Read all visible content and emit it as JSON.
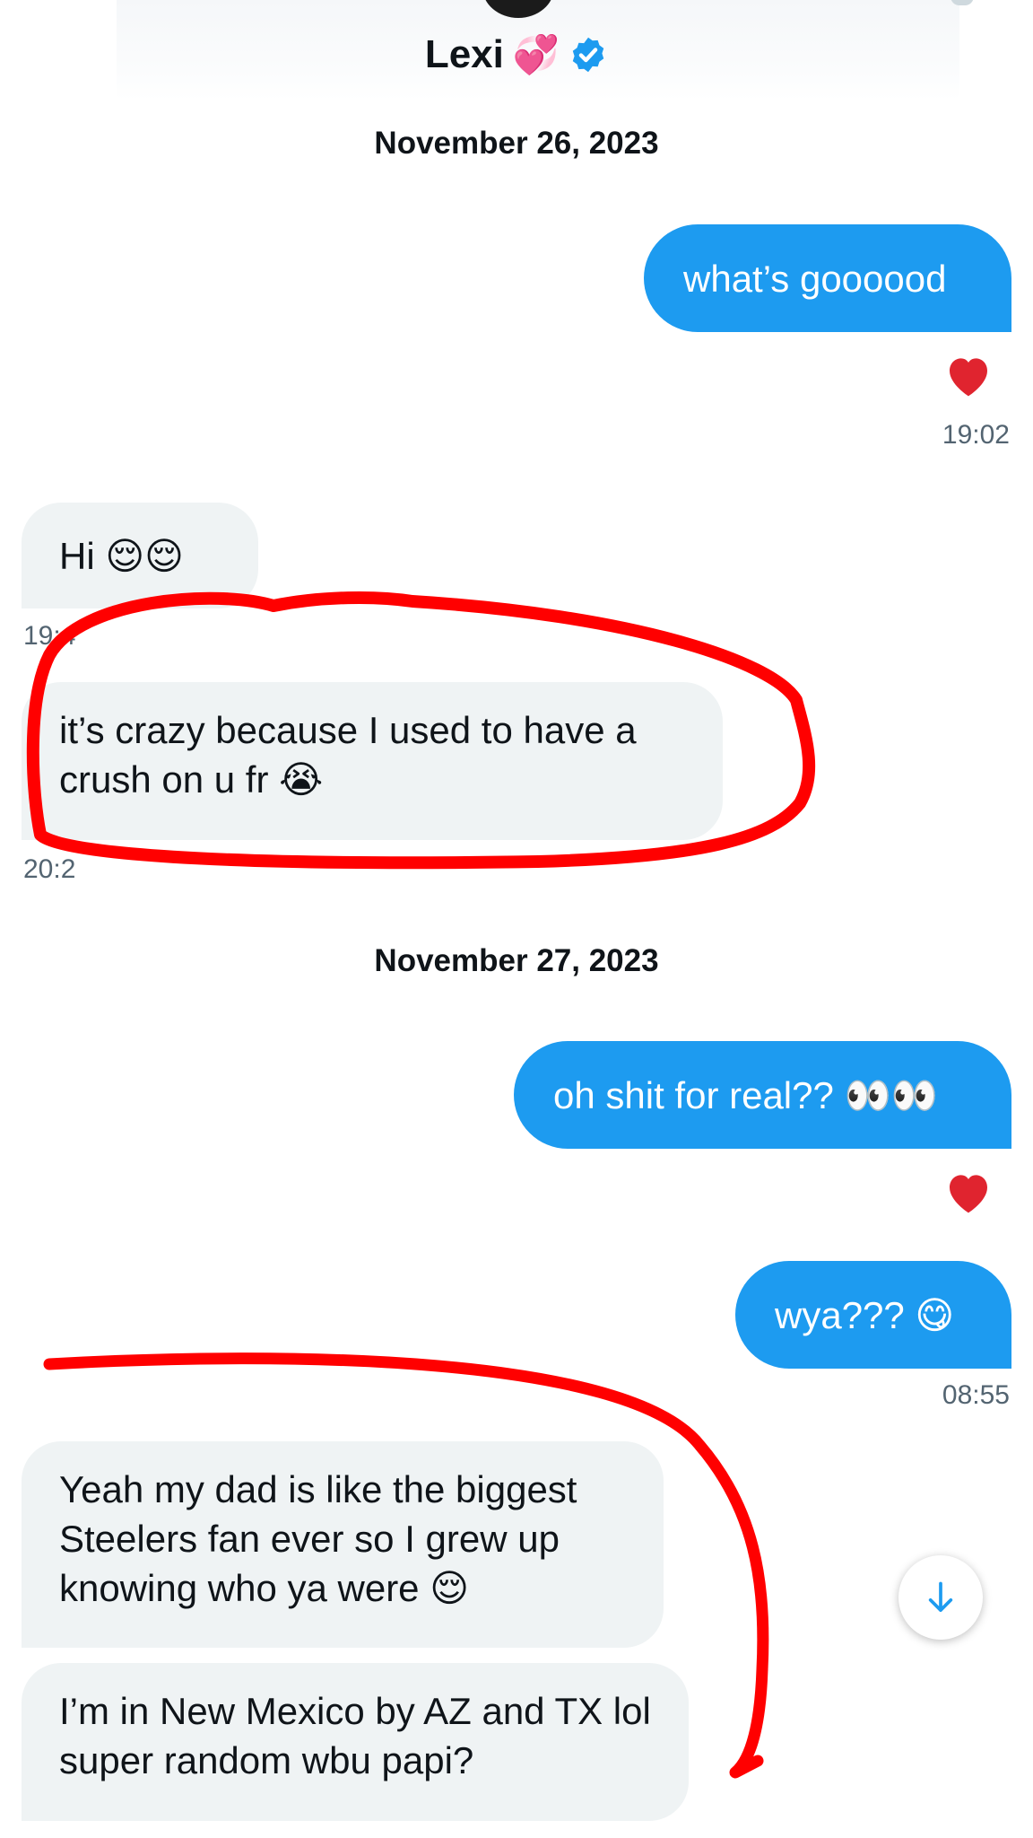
{
  "header": {
    "name": "Lexi",
    "name_emoji": "💞",
    "verified_icon": "verified-badge-icon"
  },
  "dates": [
    "November 26, 2023",
    "November 27, 2023"
  ],
  "messages": [
    {
      "side": "out",
      "text": "what’s goooood",
      "reaction": "❤️",
      "time": "19:02"
    },
    {
      "side": "in",
      "text": "Hi 😌😌",
      "time": "19:4"
    },
    {
      "side": "in",
      "text": "it’s crazy because I used to have a crush on u fr 😭",
      "time": "20:2"
    },
    {
      "side": "out",
      "text": "oh shit for real?? 👀👀",
      "reaction": "❤️"
    },
    {
      "side": "out",
      "text": "wya??? 😋",
      "time": "08:55"
    },
    {
      "side": "in",
      "text": "Yeah my dad is like the biggest Steelers fan ever so I grew up knowing who ya were 😌"
    },
    {
      "side": "in",
      "text": "I’m in New Mexico by AZ and TX lol super random wbu papi?"
    }
  ],
  "scroll_button": {
    "icon": "arrow-down-icon"
  },
  "colors": {
    "outgoing_bubble": "#1d9bf0",
    "incoming_bubble": "#eff3f4",
    "timestamp": "#536471",
    "annotation_ink": "#ff0000"
  }
}
